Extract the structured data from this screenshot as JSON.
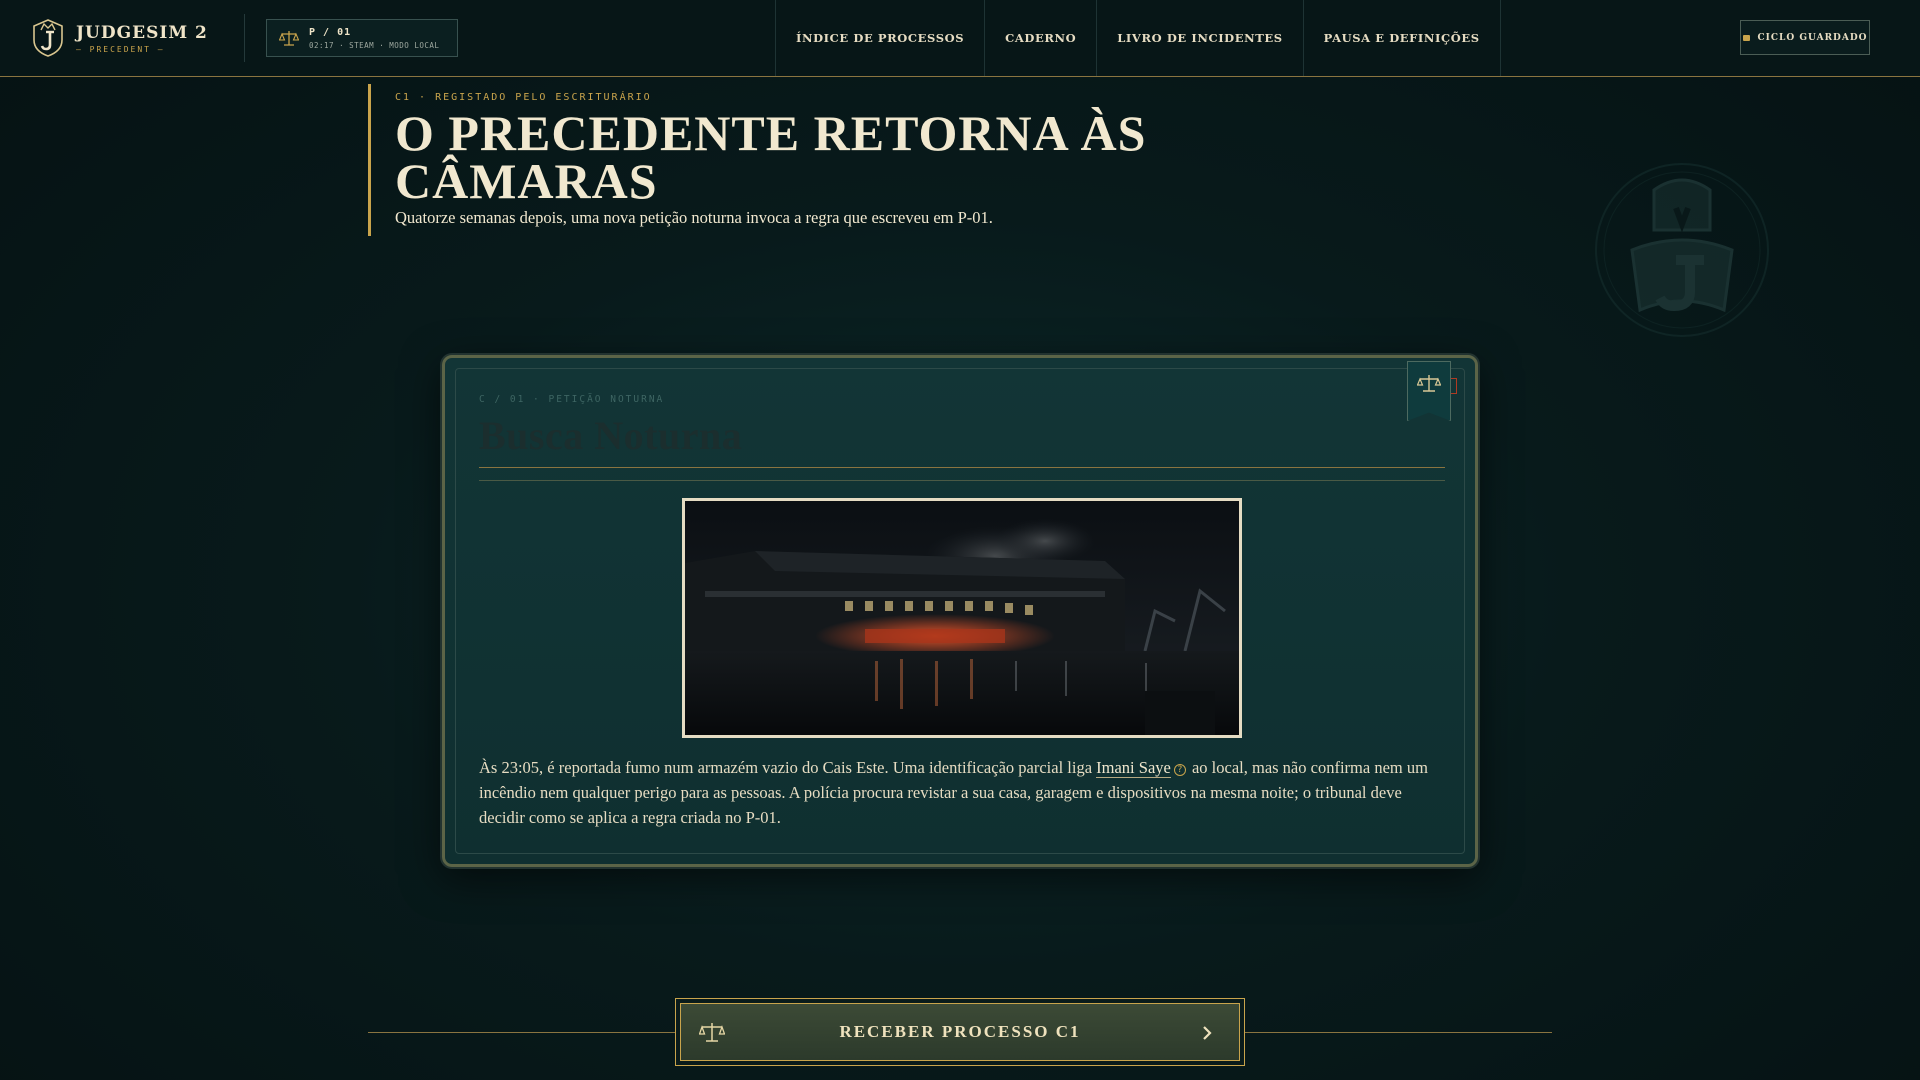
{
  "app": {
    "title": "JUDGESIM 2",
    "subtitle": "— PRECEDENT —"
  },
  "session": {
    "id": "P / 01",
    "meta": "02:17 · STEAM · MODO LOCAL"
  },
  "nav": {
    "items": [
      {
        "label": "ÍNDICE DE PROCESSOS"
      },
      {
        "label": "CADERNO"
      },
      {
        "label": "LIVRO DE INCIDENTES"
      },
      {
        "label": "PAUSA E DEFINIÇÕES"
      }
    ]
  },
  "save": {
    "label": "CICLO GUARDADO"
  },
  "header": {
    "kicker": "C1 · REGISTADO PELO ESCRITURÁRIO",
    "title": "O PRECEDENTE RETORNA ÀS CÂMARAS",
    "subtitle": "Quatorze semanas depois, uma nova petição noturna invoca a regra que escreveu em P-01."
  },
  "card": {
    "kicker": "C / 01 · PETIÇÃO NOTURNA",
    "title": "Busca Noturna",
    "body_pre": "Às 23:05, é reportada fumo num armazém vazio do Cais Este. Uma identificação parcial liga ",
    "person": "Imani Saye",
    "body_post": " ao local, mas não confirma nem um incêndio nem qualquer perigo para as pessoas. A polícia procura revistar a sua casa, garagem e dispositivos na mesma noite; o tribunal deve decidir como se aplica a regra criada no P-01."
  },
  "cta": {
    "label": "RECEBER PROCESSO C1"
  },
  "colors": {
    "accent_gold": "#c9a44c",
    "background": "#081a1b",
    "card_teal": "#123536",
    "ribbon_red": "#b03a22"
  },
  "icons": {
    "brand": "judgesim-crest-icon",
    "session": "scales-icon",
    "save": "save-indicator-icon",
    "help": "help-icon",
    "cta": "scales-icon",
    "chevron": "chevron-right-icon"
  }
}
